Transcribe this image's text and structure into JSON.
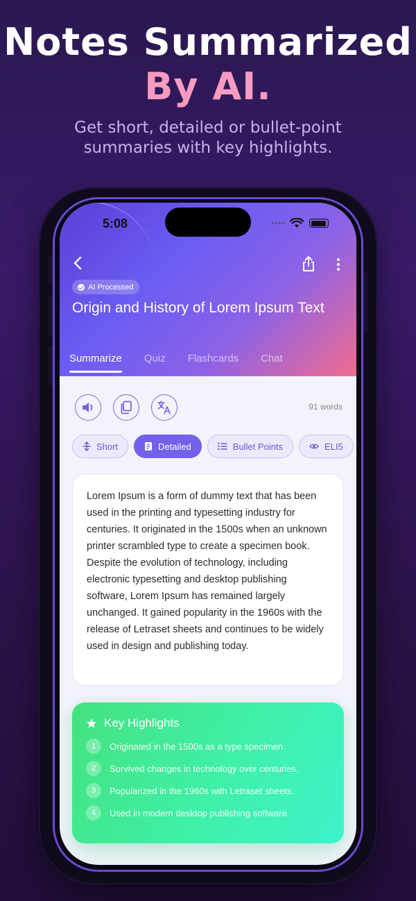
{
  "hero": {
    "title_line1": "Notes Summarized",
    "title_line2": "By AI.",
    "subtitle": "Get short, detailed or bullet-point summaries with key highlights."
  },
  "status_bar": {
    "time": "5:08"
  },
  "header": {
    "badge": "AI Processed",
    "title": "Origin and History of Lorem Ipsum Text"
  },
  "tabs": [
    {
      "label": "Summarize",
      "active": true
    },
    {
      "label": "Quiz",
      "active": false
    },
    {
      "label": "Flashcards",
      "active": false
    },
    {
      "label": "Chat",
      "active": false
    }
  ],
  "toolbar": {
    "word_count": "91 words"
  },
  "modes": [
    {
      "label": "Short",
      "icon": "short-icon",
      "active": false
    },
    {
      "label": "Detailed",
      "icon": "document-icon",
      "active": true
    },
    {
      "label": "Bullet Points",
      "icon": "list-icon",
      "active": false
    },
    {
      "label": "ELI5",
      "icon": "eye-icon",
      "active": false
    }
  ],
  "summary": {
    "text": "Lorem Ipsum is a form of dummy text that has been used in the printing and typesetting industry for centuries. It originated in the 1500s when an unknown printer scrambled type to create a specimen book. Despite the evolution of technology, including electronic typesetting and desktop publishing software, Lorem Ipsum has remained largely unchanged. It gained popularity in the 1960s with the release of Letraset sheets and continues to be widely used in design and publishing today."
  },
  "highlights": {
    "title": "Key Highlights",
    "items": [
      {
        "num": "1",
        "text": "Originated in the 1500s as a type specimen."
      },
      {
        "num": "2",
        "text": "Survived changes in technology over centuries."
      },
      {
        "num": "3",
        "text": "Popularized in the 1960s with Letraset sheets."
      },
      {
        "num": "4",
        "text": "Used in modern desktop publishing software."
      }
    ]
  },
  "colors": {
    "accent": "#7262ea",
    "hero_pink": "#f79bc0",
    "highlight_green": "#3ff0a8"
  }
}
